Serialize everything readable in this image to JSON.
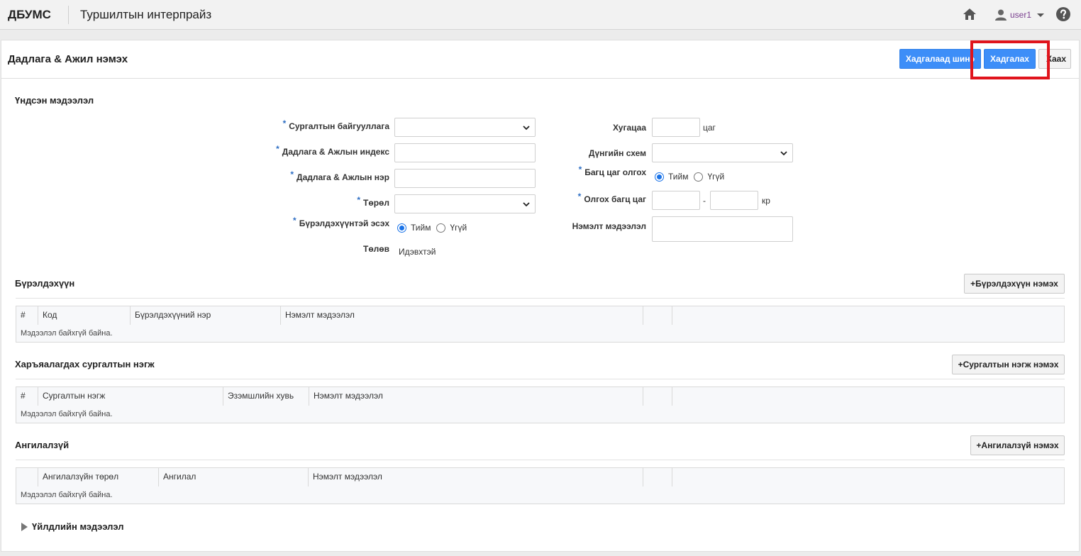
{
  "header": {
    "brand": "ДБУМС",
    "app_title": "Туршилтын интерпрайз",
    "user_name": "user1"
  },
  "page": {
    "title": "Дадлага & Ажил нэмэх",
    "save_new_label": "Хадгалаад шинэ",
    "save_label": "Хадгалах",
    "close_label": "Хаах"
  },
  "basic": {
    "section_title": "Үндсэн мэдээлэл",
    "req_mark": "*",
    "org_label": "Сургалтын байгууллага",
    "index_label": "Дадлага & Ажлын индекс",
    "name_label": "Дадлага & Ажлын нэр",
    "type_label": "Төрөл",
    "has_components_label": "Бүрэлдэхүүнтэй эсэх",
    "status_label": "Төлөв",
    "status_value": "Идэвхтэй",
    "duration_label": "Хугацаа",
    "duration_unit": "цаг",
    "grade_scheme_label": "Дүнгийн схем",
    "credit_label": "Багц цаг олгох",
    "credit_range_label": "Олгох багц цаг",
    "range_dash": "-",
    "credit_unit": "кр",
    "note_label": "Нэмэлт мэдээлэл",
    "yes_label": "Тийм",
    "no_label": "Үгүй"
  },
  "components": {
    "section_title": "Бүрэлдэхүүн",
    "add_label": "+Бүрэлдэхүүн нэмэх",
    "columns": [
      "#",
      "Код",
      "Бүрэлдэхүүний нэр",
      "Нэмэлт мэдээлэл",
      ""
    ],
    "empty": "Мэдээлэл байхгүй байна."
  },
  "units": {
    "section_title": "Харъяалагдах сургалтын нэгж",
    "add_label": "+Сургалтын нэгж нэмэх",
    "columns": [
      "#",
      "Сургалтын нэгж",
      "Эзэмшлийн хувь",
      "Нэмэлт мэдээлэл",
      ""
    ],
    "empty": "Мэдээлэл байхгүй байна."
  },
  "categories": {
    "section_title": "Ангилалзүй",
    "add_label": "+Ангилалзүй нэмэх",
    "columns": [
      "",
      "Ангилалзүйн төрөл",
      "Ангилал",
      "Нэмэлт мэдээлэл",
      ""
    ],
    "empty": "Мэдээлэл байхгүй байна."
  },
  "activity": {
    "label": "Үйлдлийн мэдээлэл"
  },
  "colors": {
    "primary": "#3d8ef8",
    "highlight": "#e0141c",
    "required": "#2f6fc4",
    "user": "#7a3f8f"
  }
}
